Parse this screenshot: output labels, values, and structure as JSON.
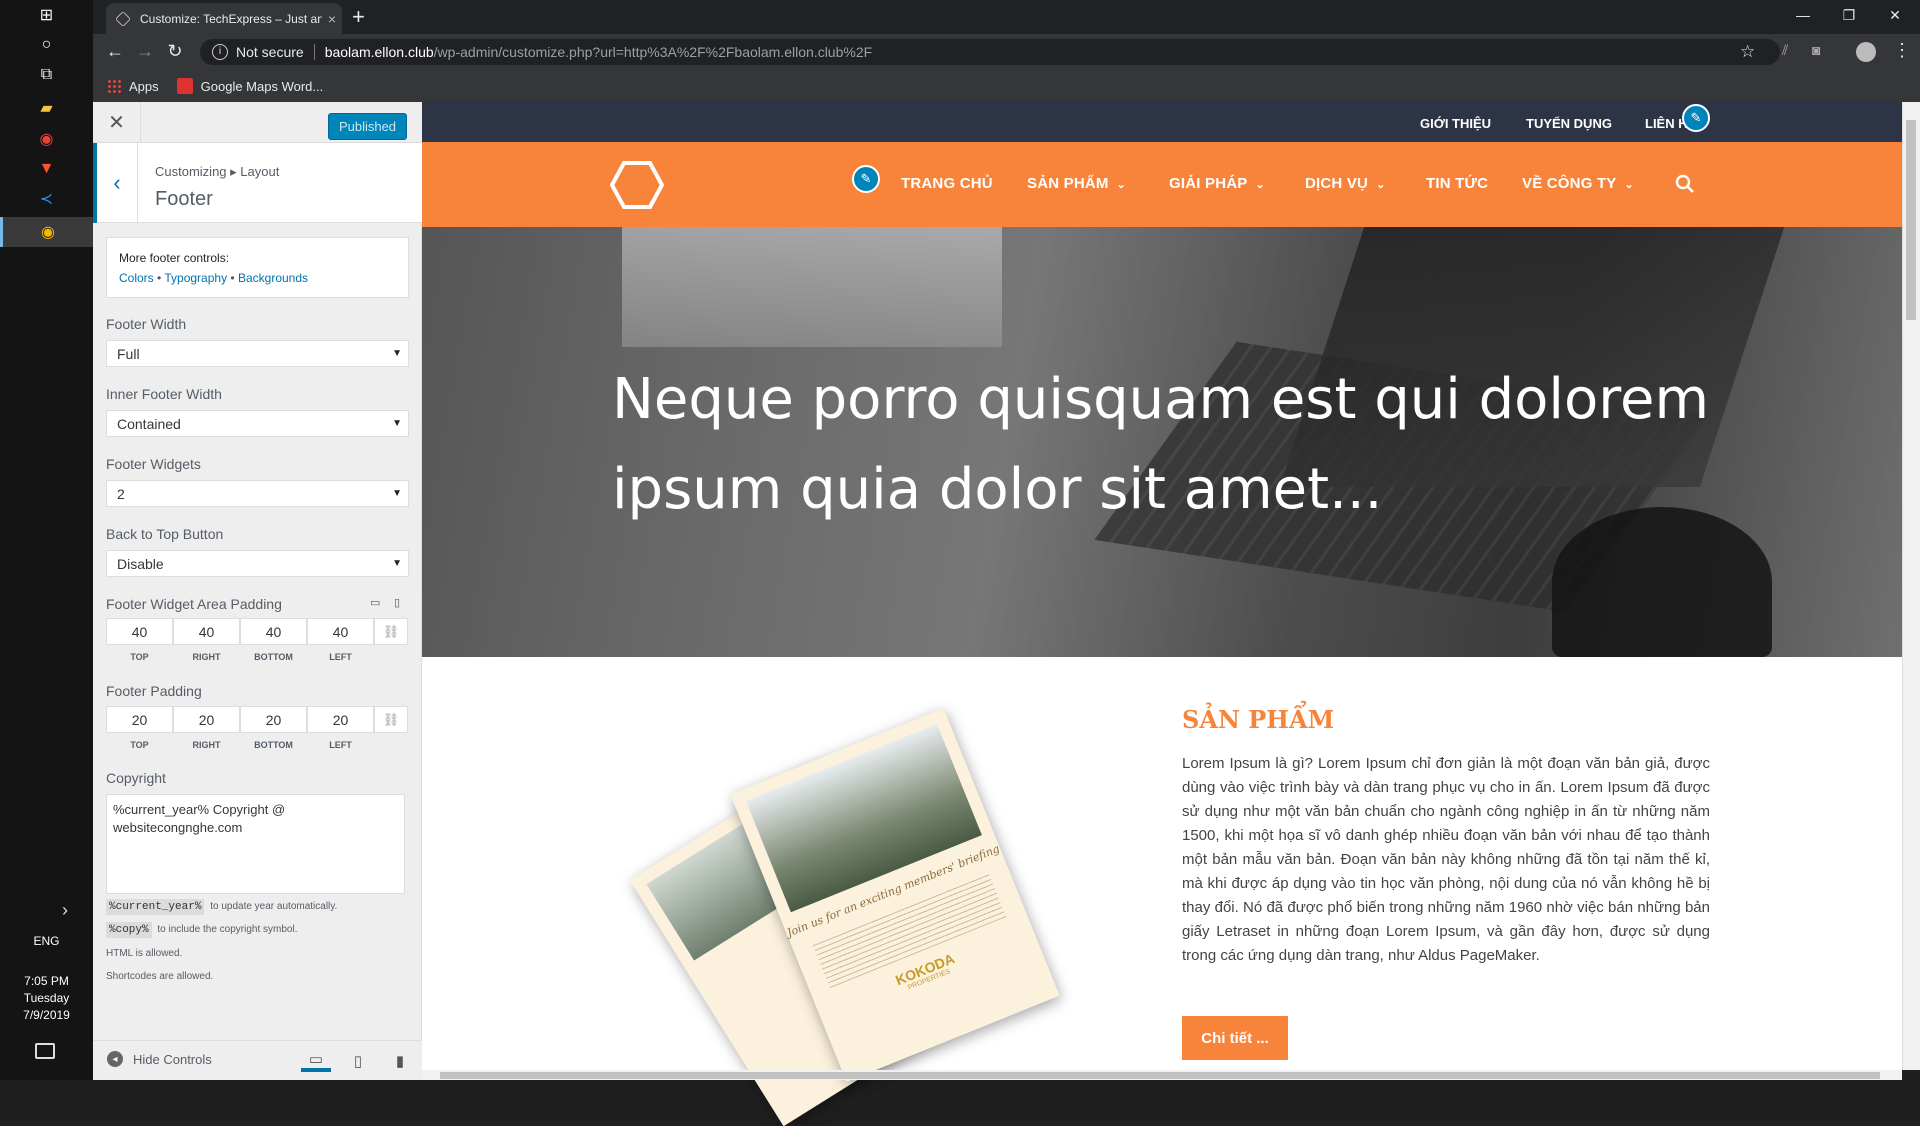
{
  "taskbar": {
    "icons": [
      "windows-start-icon",
      "search-circle-icon",
      "task-view-icon",
      "file-explorer-icon",
      "chrome-icon",
      "brave-icon",
      "vscode-icon",
      "chrome-canary-icon"
    ],
    "language": "ENG",
    "time": "7:05 PM",
    "day": "Tuesday",
    "date": "7/9/2019"
  },
  "browser": {
    "tab_title": "Customize: TechExpress – Just an",
    "tab_close": "×",
    "new_tab": "+",
    "security_label": "Not secure",
    "url_host": "baolam.ellon.club",
    "url_path": "/wp-admin/customize.php?url=http%3A%2F%2Fbaolam.ellon.club%2F",
    "bookmarks": [
      "Apps",
      "Google Maps Word..."
    ]
  },
  "customizer": {
    "publish_label": "Published",
    "breadcrumb": "Customizing ▸ Layout",
    "section_title": "Footer",
    "more_controls_title": "More footer controls:",
    "more_links": [
      "Colors",
      "Typography",
      "Backgrounds"
    ],
    "footer_width_label": "Footer Width",
    "footer_width_value": "Full",
    "inner_footer_width_label": "Inner Footer Width",
    "inner_footer_width_value": "Contained",
    "footer_widgets_label": "Footer Widgets",
    "footer_widgets_value": "2",
    "back_to_top_label": "Back to Top Button",
    "back_to_top_value": "Disable",
    "widget_padding_label": "Footer Widget Area Padding",
    "widget_padding": [
      "40",
      "40",
      "40",
      "40"
    ],
    "footer_padding_label": "Footer Padding",
    "footer_padding": [
      "20",
      "20",
      "20",
      "20"
    ],
    "padding_sides": [
      "TOP",
      "RIGHT",
      "BOTTOM",
      "LEFT"
    ],
    "copyright_label": "Copyright",
    "copyright_value": "%current_year% Copyright @\nwebsitecongnghe.com",
    "note_year_code": "%current_year%",
    "note_year_text": "to update year automatically.",
    "note_copy_code": "%copy%",
    "note_copy_text": "to include the copyright symbol.",
    "note_html": "HTML is allowed.",
    "note_shortcodes": "Shortcodes are allowed.",
    "hide_controls": "Hide Controls"
  },
  "site": {
    "top_links": [
      "GIỚI THIỆU",
      "TUYỂN DỤNG",
      "LIÊN H"
    ],
    "nav": [
      {
        "label": "TRANG CHỦ",
        "caret": false
      },
      {
        "label": "SẢN PHẨM",
        "caret": true
      },
      {
        "label": "GIẢI PHÁP",
        "caret": true
      },
      {
        "label": "DỊCH VỤ",
        "caret": true
      },
      {
        "label": "TIN TỨC",
        "caret": false
      },
      {
        "label": "VỀ CÔNG TY",
        "caret": true
      }
    ],
    "hero_title": "Neque porro quisquam est qui dolorem ipsum quia dolor sit amet...",
    "product_title": "SẢN PHẨM",
    "product_body": "Lorem Ipsum là gì? Lorem Ipsum chỉ đơn giản là một đoạn văn bản giả, được dùng vào việc trình bày và dàn trang phục vụ cho in ấn. Lorem Ipsum đã được sử dụng như một văn bản chuẩn cho ngành công nghiệp in ấn từ những năm 1500, khi một họa sĩ vô danh ghép nhiều đoạn văn bản với nhau để tạo thành một bản mẫu văn bản. Đoạn văn bản này không những đã tồn tại năm thế kỉ, mà khi được áp dụng vào tin học văn phòng, nội dung của nó vẫn không hề bị thay đổi. Nó đã được phổ biến trong những năm 1960 nhờ việc bán những bản giấy Letraset in những đoạn Lorem Ipsum, và gần đây hơn, được sử dụng trong các ứng dụng dàn trang, như Aldus PageMaker.",
    "product_button": "Chi tiết ...",
    "flyer_text": "Join us for an exciting members' briefing",
    "flyer_brand": "KOKODA",
    "flyer_brand_sub": "PROPERTIES"
  },
  "colors": {
    "accent_orange": "#f7843a",
    "topbar_navy": "#2c3446",
    "wp_blue": "#0085ba"
  }
}
